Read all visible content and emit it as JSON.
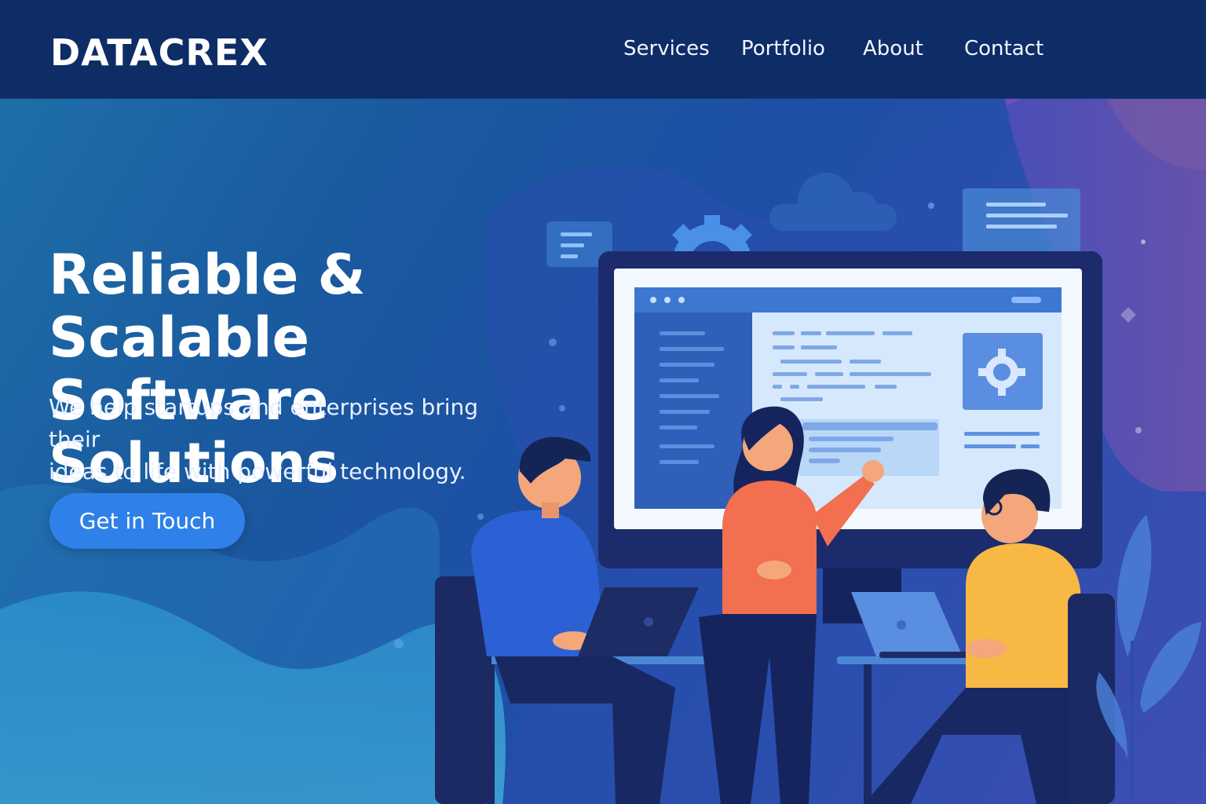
{
  "header": {
    "brand": "DATACREX",
    "nav": [
      {
        "label": "Services"
      },
      {
        "label": "Portfolio"
      },
      {
        "label": "About"
      },
      {
        "label": "Contact"
      }
    ]
  },
  "hero": {
    "headline_line1": "Reliable & Scalable",
    "headline_line2": "Software Solutions",
    "subtext_line1": "We help startups and enterprises bring their",
    "subtext_line2": "ideas to life with powerful technology.",
    "cta_label": "Get in Touch"
  },
  "colors": {
    "header_bg": "#0e2c66",
    "accent": "#2f80e8",
    "orange_shirt": "#f26f4f",
    "yellow_shirt": "#f7b844"
  },
  "icons": [
    "gear-icon",
    "cloud-icon"
  ]
}
